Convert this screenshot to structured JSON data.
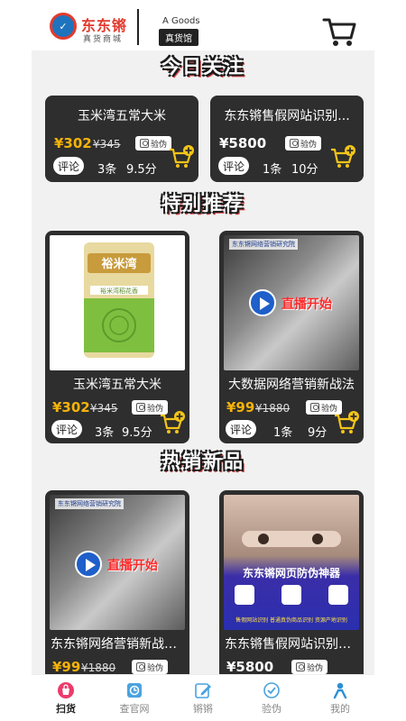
{
  "header": {
    "logo_text": "东东锵",
    "brand_name": "东东锵",
    "brand_sub": "真货商城",
    "goods_label": "A Goods",
    "goods_badge": "真货馆"
  },
  "sections": {
    "today": "今日关注",
    "recommend": "特别推荐",
    "hot": "热销新品"
  },
  "common": {
    "comment_label": "评论",
    "verify_label": "验伪"
  },
  "today_items": [
    {
      "title": "玉米湾五常大米",
      "price": "¥302",
      "old_price": "¥345",
      "reviews": "3条",
      "score": "9.5分"
    },
    {
      "title": "东东锵售假网站识别...",
      "price": "¥5800",
      "old_price": "",
      "reviews": "1条",
      "score": "10分"
    }
  ],
  "recommend_items": [
    {
      "title": "玉米湾五常大米",
      "price": "¥302",
      "old_price": "¥345",
      "reviews": "3条",
      "score": "9.5分",
      "image_text": "裕米湾",
      "image_sub": "裕米湾稻花香"
    },
    {
      "title": "大数据网络营销新战法",
      "price": "¥99",
      "old_price": "¥1880",
      "reviews": "1条",
      "score": "9分",
      "image_text": "直播开始",
      "image_sub": "东东锵网络营销研究院"
    }
  ],
  "hot_items": [
    {
      "title": "东东锵网络营销新战法揭...",
      "price": "¥99",
      "old_price": "¥1880",
      "image_text": "直播开始",
      "image_sub": "东东锵网络营销研究院"
    },
    {
      "title": "东东锵售假网站识别系统",
      "price": "¥5800",
      "old_price": "",
      "image_text": "东东锵网页防伪神器",
      "image_sub": "售假网站识别 普通真伪商品识别 资源产地识别"
    }
  ],
  "nav": [
    {
      "label": "扫货",
      "icon": "shop-bag-icon",
      "active": true
    },
    {
      "label": "查官网",
      "icon": "official-site-icon",
      "active": false
    },
    {
      "label": "锵锵",
      "icon": "edit-icon",
      "active": false
    },
    {
      "label": "验伪",
      "icon": "verify-icon",
      "active": false
    },
    {
      "label": "我的",
      "icon": "user-icon",
      "active": false
    }
  ],
  "colors": {
    "price_accent": "#f5b30a",
    "card_bg": "#2e2e2e",
    "brand_red": "#e23b2e",
    "brand_blue": "#1e73be"
  }
}
